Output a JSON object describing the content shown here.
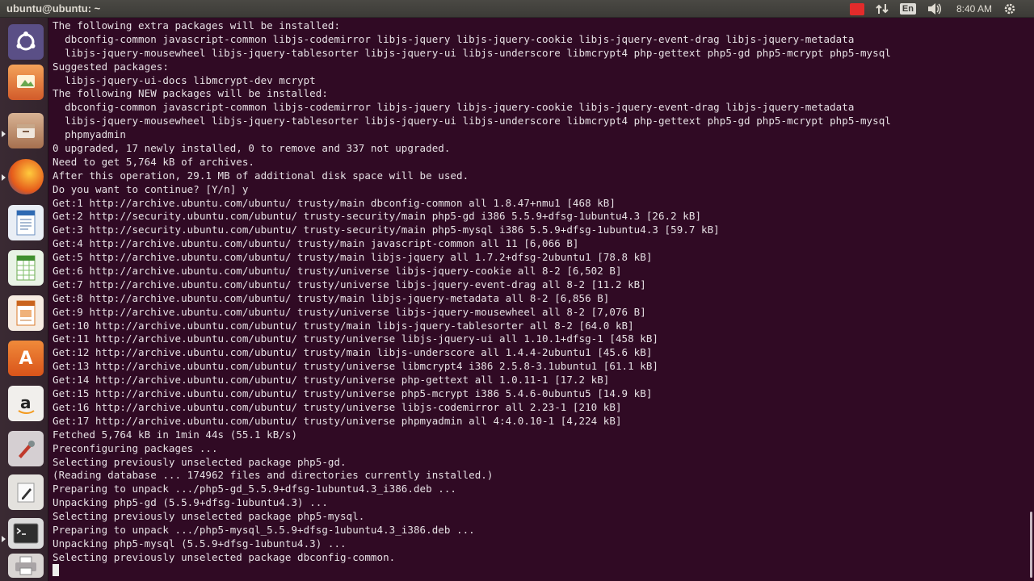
{
  "window": {
    "title": "ubuntu@ubuntu: ~"
  },
  "panel": {
    "language": "En",
    "clock": "8:40 AM",
    "indicators": [
      {
        "name": "red-notification-icon",
        "glyph": ""
      },
      {
        "name": "network-transfer-icon",
        "glyph": "⇅"
      },
      {
        "name": "keyboard-language-indicator"
      },
      {
        "name": "volume-icon",
        "glyph": "🔊"
      },
      {
        "name": "clock"
      },
      {
        "name": "gear-icon",
        "glyph": "⚙"
      }
    ]
  },
  "launcher": {
    "items": [
      {
        "name": "dash-home-icon",
        "glyph": "◎",
        "bg": "#5f6bb0"
      },
      {
        "name": "system-settings-icon",
        "glyph": "⚒",
        "bg": "#d86a3c"
      },
      {
        "name": "files-icon",
        "glyph": "▭",
        "bg": "#b98b6a"
      },
      {
        "name": "firefox-icon",
        "glyph": "◉",
        "bg": "#e5661c"
      },
      {
        "name": "libreoffice-writer-icon",
        "glyph": "≡",
        "bg": "#3a78c2"
      },
      {
        "name": "libreoffice-calc-icon",
        "glyph": "▦",
        "bg": "#4aa34a"
      },
      {
        "name": "libreoffice-impress-icon",
        "glyph": "▤",
        "bg": "#d97a2a"
      },
      {
        "name": "ubuntu-software-center-icon",
        "glyph": "A",
        "bg": "#e2682a"
      },
      {
        "name": "amazon-icon",
        "glyph": "a",
        "bg": "#e9e6e1"
      },
      {
        "name": "system-tools-icon",
        "glyph": "✎",
        "bg": "#c9c3c7"
      },
      {
        "name": "text-editor-icon",
        "glyph": "✐",
        "bg": "#d8d6d2"
      },
      {
        "name": "terminal-icon",
        "glyph": ">_",
        "bg": "#2f2f2f"
      },
      {
        "name": "printer-icon",
        "glyph": "⎙",
        "bg": "#c9c3c7"
      },
      {
        "name": "trash-icon",
        "glyph": "",
        "bg": "#6a6a6a"
      }
    ]
  },
  "terminal": {
    "lines": [
      "The following extra packages will be installed:",
      "  dbconfig-common javascript-common libjs-codemirror libjs-jquery libjs-jquery-cookie libjs-jquery-event-drag libjs-jquery-metadata",
      "  libjs-jquery-mousewheel libjs-jquery-tablesorter libjs-jquery-ui libjs-underscore libmcrypt4 php-gettext php5-gd php5-mcrypt php5-mysql",
      "Suggested packages:",
      "  libjs-jquery-ui-docs libmcrypt-dev mcrypt",
      "The following NEW packages will be installed:",
      "  dbconfig-common javascript-common libjs-codemirror libjs-jquery libjs-jquery-cookie libjs-jquery-event-drag libjs-jquery-metadata",
      "  libjs-jquery-mousewheel libjs-jquery-tablesorter libjs-jquery-ui libjs-underscore libmcrypt4 php-gettext php5-gd php5-mcrypt php5-mysql",
      "  phpmyadmin",
      "0 upgraded, 17 newly installed, 0 to remove and 337 not upgraded.",
      "Need to get 5,764 kB of archives.",
      "After this operation, 29.1 MB of additional disk space will be used.",
      "Do you want to continue? [Y/n] y",
      "Get:1 http://archive.ubuntu.com/ubuntu/ trusty/main dbconfig-common all 1.8.47+nmu1 [468 kB]",
      "Get:2 http://security.ubuntu.com/ubuntu/ trusty-security/main php5-gd i386 5.5.9+dfsg-1ubuntu4.3 [26.2 kB]",
      "Get:3 http://security.ubuntu.com/ubuntu/ trusty-security/main php5-mysql i386 5.5.9+dfsg-1ubuntu4.3 [59.7 kB]",
      "Get:4 http://archive.ubuntu.com/ubuntu/ trusty/main javascript-common all 11 [6,066 B]",
      "Get:5 http://archive.ubuntu.com/ubuntu/ trusty/main libjs-jquery all 1.7.2+dfsg-2ubuntu1 [78.8 kB]",
      "Get:6 http://archive.ubuntu.com/ubuntu/ trusty/universe libjs-jquery-cookie all 8-2 [6,502 B]",
      "Get:7 http://archive.ubuntu.com/ubuntu/ trusty/universe libjs-jquery-event-drag all 8-2 [11.2 kB]",
      "Get:8 http://archive.ubuntu.com/ubuntu/ trusty/main libjs-jquery-metadata all 8-2 [6,856 B]",
      "Get:9 http://archive.ubuntu.com/ubuntu/ trusty/universe libjs-jquery-mousewheel all 8-2 [7,076 B]",
      "Get:10 http://archive.ubuntu.com/ubuntu/ trusty/main libjs-jquery-tablesorter all 8-2 [64.0 kB]",
      "Get:11 http://archive.ubuntu.com/ubuntu/ trusty/universe libjs-jquery-ui all 1.10.1+dfsg-1 [458 kB]",
      "Get:12 http://archive.ubuntu.com/ubuntu/ trusty/main libjs-underscore all 1.4.4-2ubuntu1 [45.6 kB]",
      "Get:13 http://archive.ubuntu.com/ubuntu/ trusty/universe libmcrypt4 i386 2.5.8-3.1ubuntu1 [61.1 kB]",
      "Get:14 http://archive.ubuntu.com/ubuntu/ trusty/universe php-gettext all 1.0.11-1 [17.2 kB]",
      "Get:15 http://archive.ubuntu.com/ubuntu/ trusty/universe php5-mcrypt i386 5.4.6-0ubuntu5 [14.9 kB]",
      "Get:16 http://archive.ubuntu.com/ubuntu/ trusty/universe libjs-codemirror all 2.23-1 [210 kB]",
      "Get:17 http://archive.ubuntu.com/ubuntu/ trusty/universe phpmyadmin all 4:4.0.10-1 [4,224 kB]",
      "Fetched 5,764 kB in 1min 44s (55.1 kB/s)",
      "Preconfiguring packages ...",
      "Selecting previously unselected package php5-gd.",
      "(Reading database ... 174962 files and directories currently installed.)",
      "Preparing to unpack .../php5-gd_5.5.9+dfsg-1ubuntu4.3_i386.deb ...",
      "Unpacking php5-gd (5.5.9+dfsg-1ubuntu4.3) ...",
      "Selecting previously unselected package php5-mysql.",
      "Preparing to unpack .../php5-mysql_5.5.9+dfsg-1ubuntu4.3_i386.deb ...",
      "Unpacking php5-mysql (5.5.9+dfsg-1ubuntu4.3) ...",
      "Selecting previously unselected package dbconfig-common."
    ]
  }
}
